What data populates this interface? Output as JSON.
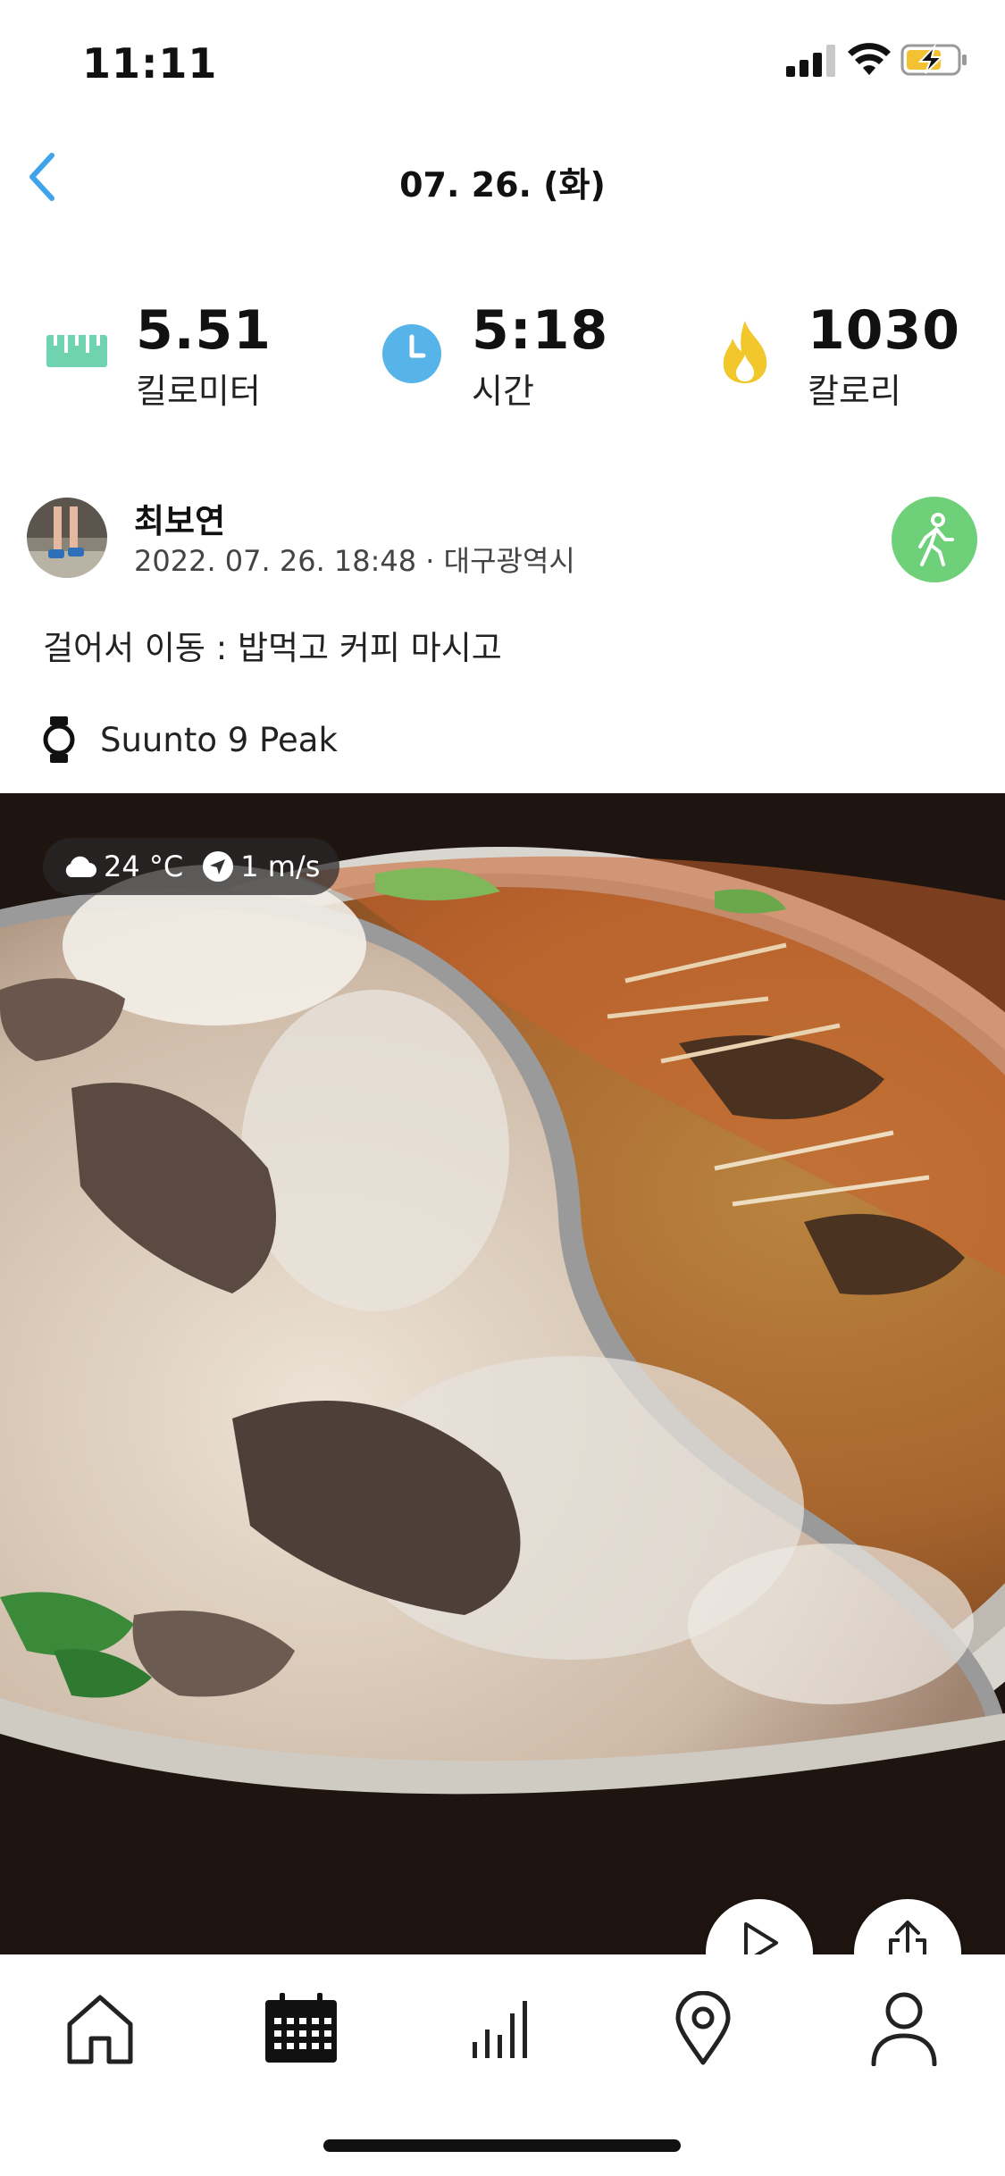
{
  "status_bar": {
    "time": "11:11"
  },
  "header": {
    "title": "07. 26. (화)"
  },
  "stats": {
    "distance": {
      "value": "5.51",
      "label": "킬로미터",
      "icon": "ruler-icon",
      "color": "#6fd3b0"
    },
    "duration": {
      "value": "5:18",
      "label": "시간",
      "icon": "clock-icon",
      "color": "#56b4e9"
    },
    "calories": {
      "value": "1030",
      "label": "칼로리",
      "icon": "flame-icon",
      "color": "#f2c72c"
    }
  },
  "post": {
    "user_name": "최보연",
    "meta": "2022. 07. 26. 18:48 · 대구광역시",
    "activity_icon": "walking-icon",
    "activity_color": "#6fd07a",
    "description": "걸어서 이동 : 밥먹고 커피 마시고",
    "device_name": "Suunto 9 Peak"
  },
  "weather": {
    "temperature": "24 °C",
    "wind": "1 m/s"
  },
  "tabs": [
    {
      "name": "home",
      "icon": "home-icon"
    },
    {
      "name": "calendar",
      "icon": "calendar-icon",
      "active": true
    },
    {
      "name": "stats",
      "icon": "bar-chart-icon"
    },
    {
      "name": "map",
      "icon": "location-pin-icon"
    },
    {
      "name": "profile",
      "icon": "person-icon"
    }
  ]
}
